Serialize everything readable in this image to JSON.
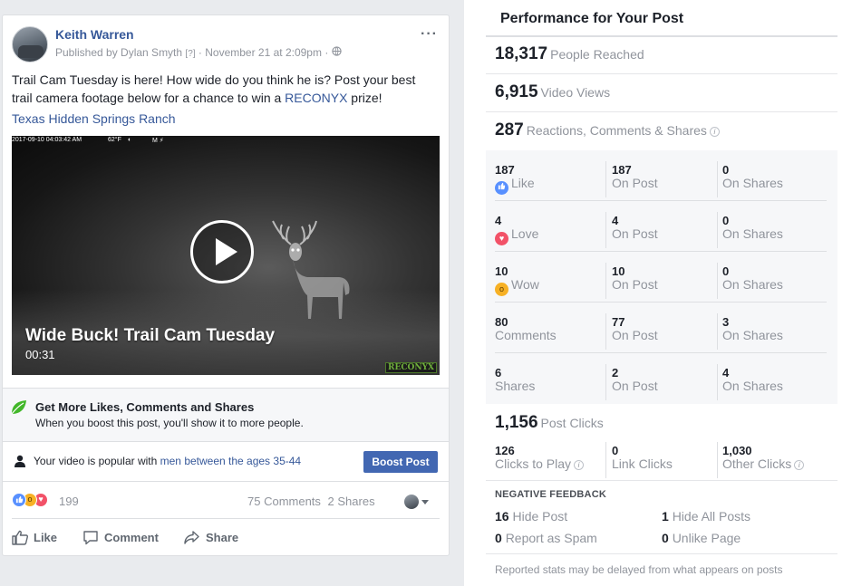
{
  "post": {
    "author": "Keith Warren",
    "published_by": "Published by Dylan Smyth",
    "help_mark": "[?]",
    "date": "November 21 at 2:09pm",
    "text_before": "Trail Cam Tuesday is here! How wide do you think he is? Post your best trail camera footage below for a chance to win a ",
    "text_link": "RECONYX",
    "text_after": " prize!",
    "location": "Texas Hidden Springs Ranch",
    "video": {
      "timestamp": "2017-09-10 04:03:42 AM",
      "temperature": "62°F",
      "moon": "◐",
      "mode": "M ⚡",
      "title": "Wide Buck! Trail Cam Tuesday",
      "duration": "00:31",
      "watermark": "RECONYX"
    },
    "boost": {
      "title": "Get More Likes, Comments and Shares",
      "subtitle": "When you boost this post, you'll show it to more people."
    },
    "popular": {
      "text": "Your video is popular with ",
      "link": "men between the ages 35-44",
      "button": "Boost Post"
    },
    "reactions": {
      "count": "199",
      "comments": "75 Comments",
      "shares": "2 Shares"
    },
    "actions": {
      "like": "Like",
      "comment": "Comment",
      "share": "Share"
    }
  },
  "performance": {
    "title": "Performance for Your Post",
    "reached": {
      "value": "18,317",
      "label": "People Reached"
    },
    "views": {
      "value": "6,915",
      "label": "Video Views"
    },
    "engagement": {
      "value": "287",
      "label": "Reactions, Comments & Shares"
    },
    "rows": [
      {
        "total": "187",
        "label": "Like",
        "on_post": "187",
        "on_post_label": "On Post",
        "on_shares": "0",
        "on_shares_label": "On Shares"
      },
      {
        "total": "4",
        "label": "Love",
        "on_post": "4",
        "on_post_label": "On Post",
        "on_shares": "0",
        "on_shares_label": "On Shares"
      },
      {
        "total": "10",
        "label": "Wow",
        "on_post": "10",
        "on_post_label": "On Post",
        "on_shares": "0",
        "on_shares_label": "On Shares"
      },
      {
        "total": "80",
        "label": "Comments",
        "on_post": "77",
        "on_post_label": "On Post",
        "on_shares": "3",
        "on_shares_label": "On Shares"
      },
      {
        "total": "6",
        "label": "Shares",
        "on_post": "2",
        "on_post_label": "On Post",
        "on_shares": "4",
        "on_shares_label": "On Shares"
      }
    ],
    "clicks": {
      "value": "1,156",
      "label": "Post Clicks"
    },
    "click_breakdown": [
      {
        "value": "126",
        "label": "Clicks to Play"
      },
      {
        "value": "0",
        "label": "Link Clicks"
      },
      {
        "value": "1,030",
        "label": "Other Clicks"
      }
    ],
    "negative": {
      "heading": "NEGATIVE FEEDBACK",
      "items": [
        {
          "value": "16",
          "label": "Hide Post"
        },
        {
          "value": "1",
          "label": "Hide All Posts"
        },
        {
          "value": "0",
          "label": "Report as Spam"
        },
        {
          "value": "0",
          "label": "Unlike Page"
        }
      ]
    },
    "footnote": "Reported stats may be delayed from what appears on posts"
  },
  "colors": {
    "link": "#365899",
    "button": "#4267b2",
    "like": "#5890ff",
    "love": "#f25268",
    "wow": "#f7b125"
  }
}
